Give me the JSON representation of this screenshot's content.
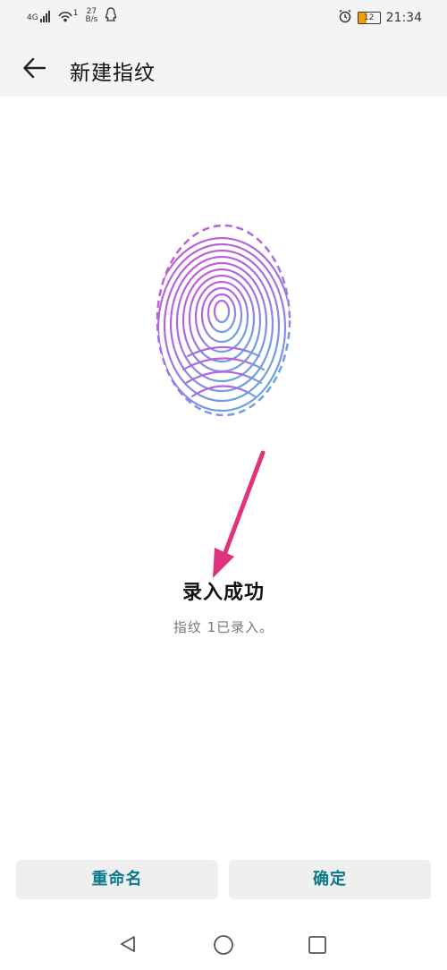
{
  "status_bar": {
    "network": "4G",
    "data_rate_value": "27",
    "data_rate_unit": "B/s",
    "wifi_index": "1",
    "battery_level": "12",
    "time": "21:34",
    "icons": [
      "signal-icon",
      "wifi-icon",
      "qq-icon",
      "alarm-icon",
      "battery-icon"
    ]
  },
  "app_bar": {
    "title": "新建指纹",
    "back_icon": "arrow-left-icon"
  },
  "result": {
    "title": "录入成功",
    "subtitle": "指纹 1已录入。"
  },
  "actions": {
    "rename_label": "重命名",
    "confirm_label": "确定"
  },
  "nav": {
    "icons": [
      "triangle-back-icon",
      "circle-home-icon",
      "square-recent-icon"
    ]
  },
  "colors": {
    "accent": "#0b7a8a",
    "fingerprint_top": "#c45ed8",
    "fingerprint_bottom": "#6f9ae6",
    "annotation_arrow": "#e0337a"
  }
}
